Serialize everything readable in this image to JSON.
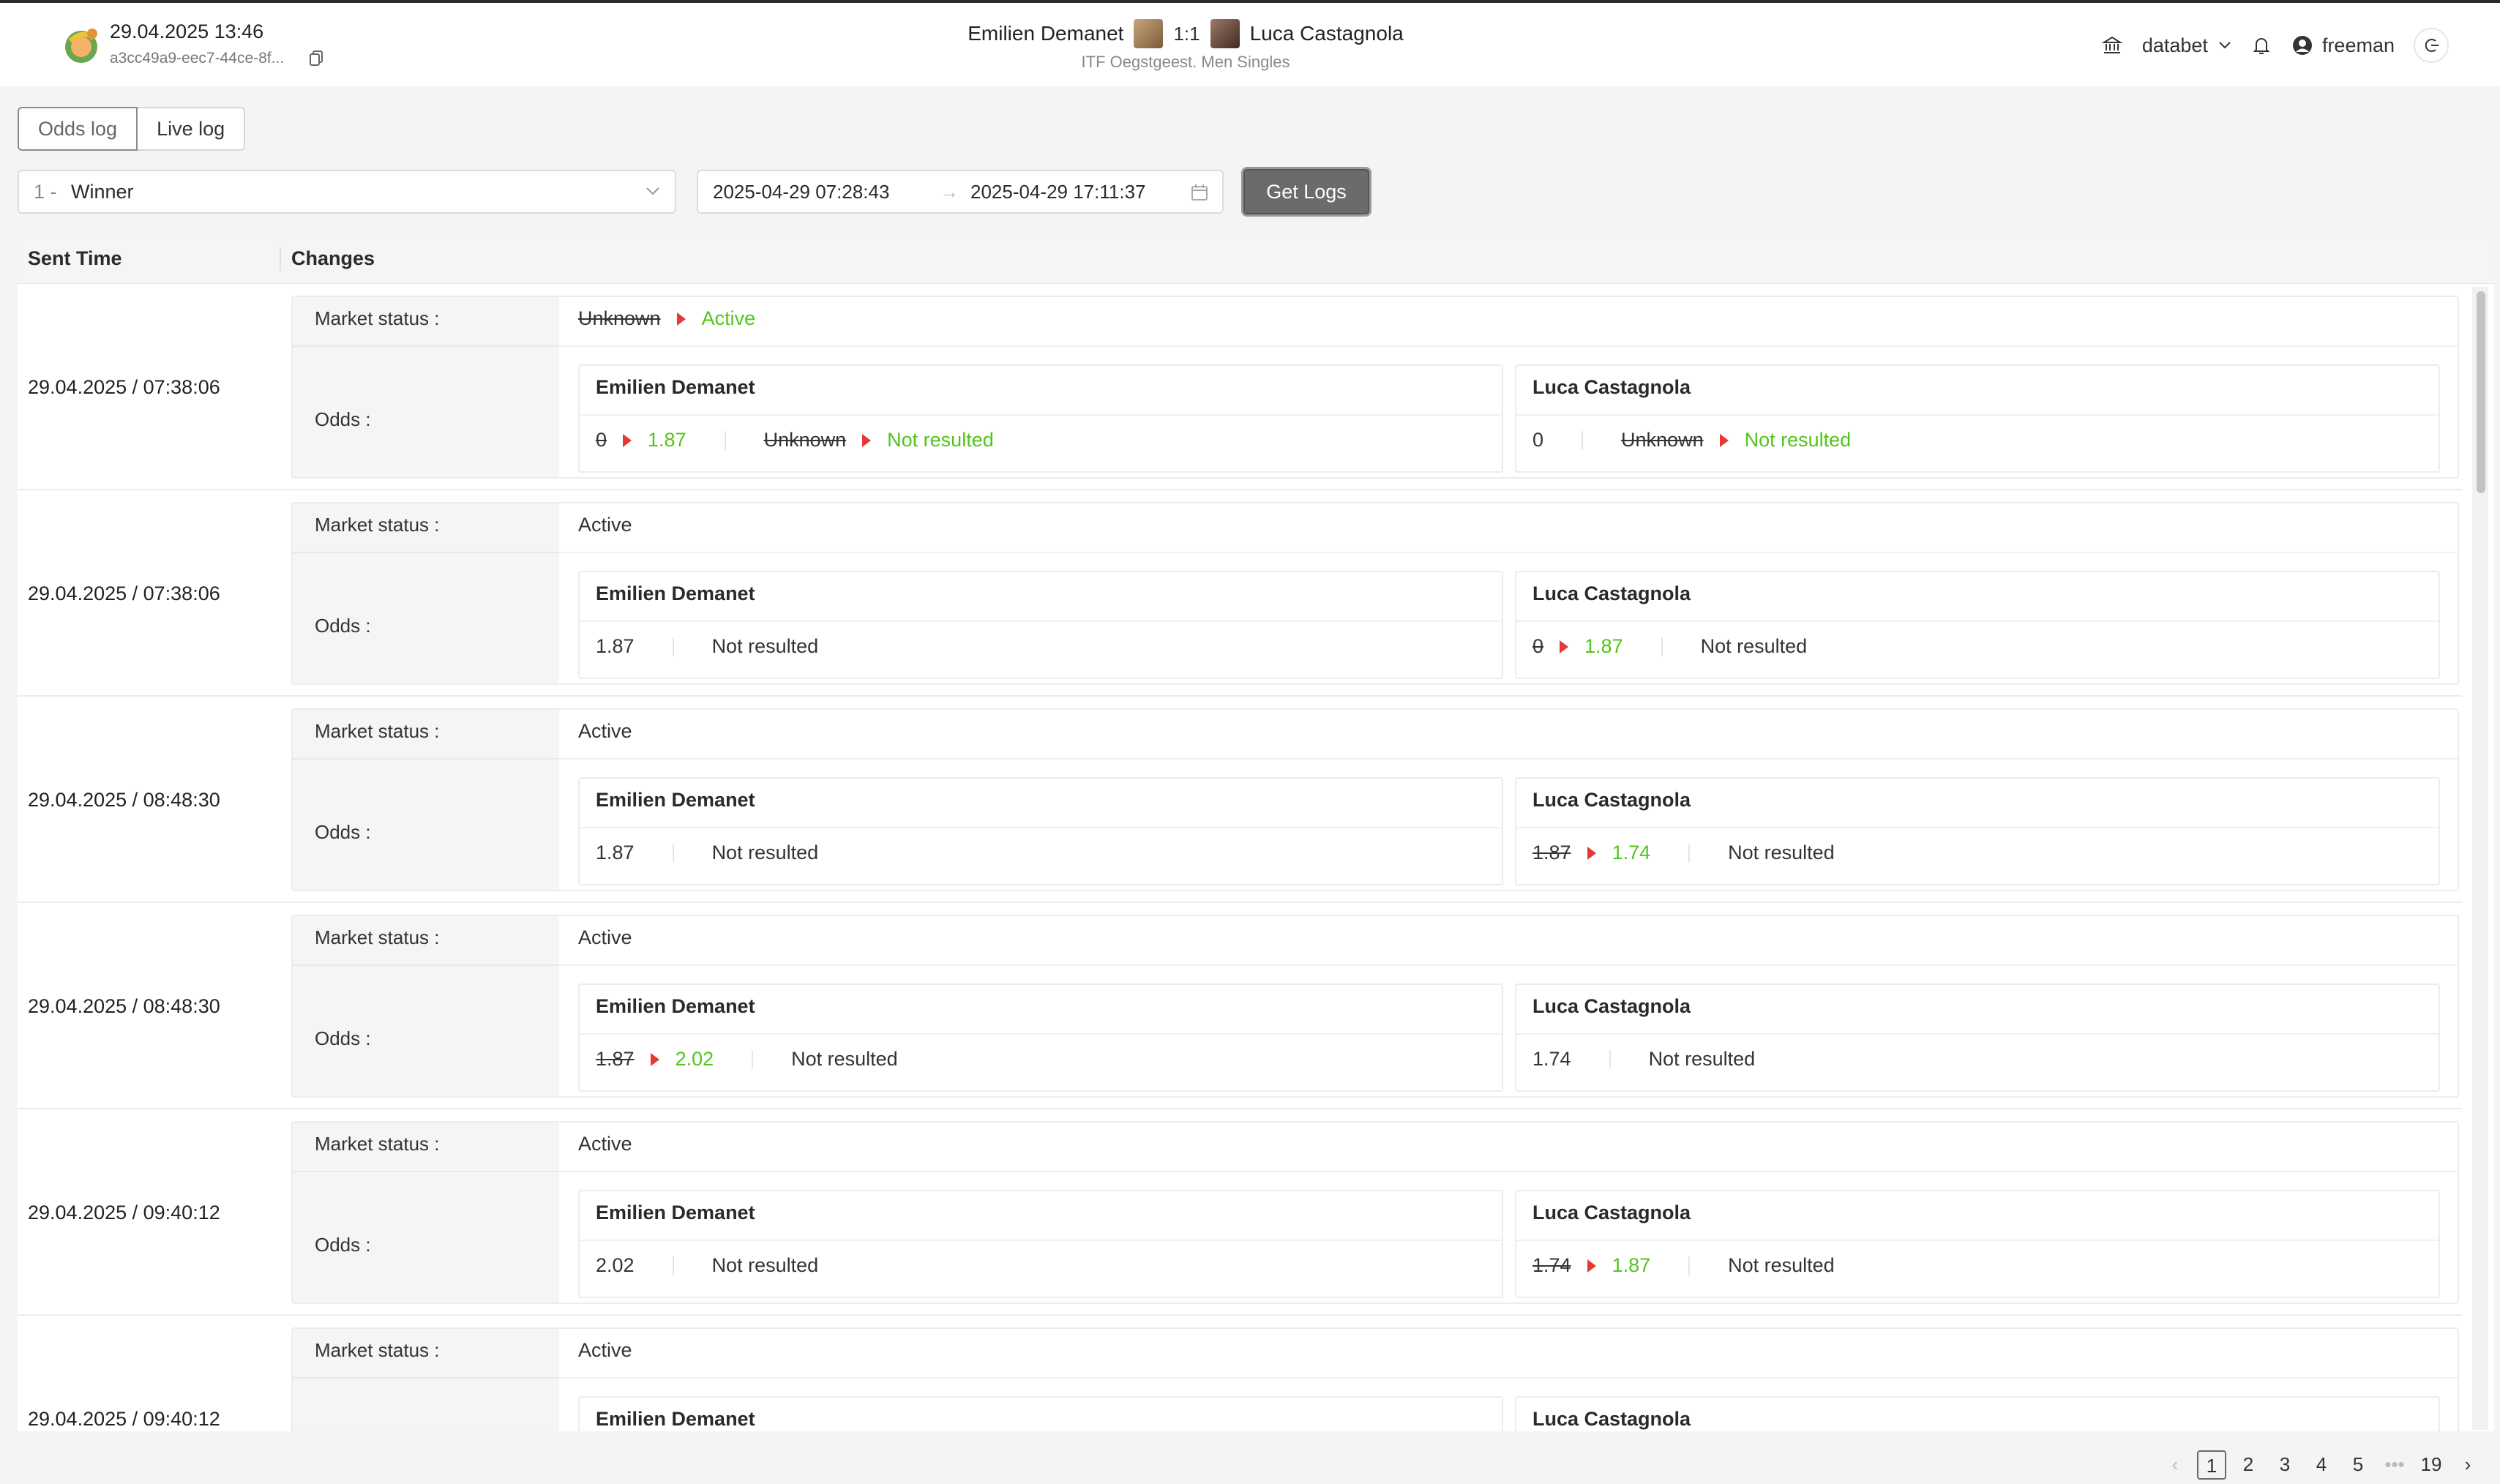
{
  "header": {
    "datetime": "29.04.2025 13:46",
    "event_id": "a3cc49a9-eec7-44ce-8f...",
    "home_player": "Emilien Demanet",
    "score": "1:1",
    "away_player": "Luca Castagnola",
    "league": "ITF Oegstgeest. Men Singles",
    "brand": "databet",
    "username": "freeman"
  },
  "tabs": [
    "Odds log",
    "Live log"
  ],
  "filters": {
    "market_number": "1 -",
    "market_name": "Winner",
    "date_from": "2025-04-29 07:28:43",
    "date_to": "2025-04-29 17:11:37",
    "get_logs_label": "Get Logs"
  },
  "table": {
    "col_sent_time": "Sent Time",
    "col_changes": "Changes",
    "market_status_label": "Market status :",
    "odds_label": "Odds :",
    "rows": [
      {
        "sent": "29.04.2025 / 07:38:06",
        "status_old": "Unknown",
        "status_new": "Active",
        "left": {
          "name": "Emilien Demanet",
          "odd_old": "0",
          "odd_new": "1.87",
          "res_old": "Unknown",
          "res_new": "Not resulted"
        },
        "right": {
          "name": "Luca Castagnola",
          "odd": "0",
          "res_old": "Unknown",
          "res_new": "Not resulted"
        }
      },
      {
        "sent": "29.04.2025 / 07:38:06",
        "status": "Active",
        "left": {
          "name": "Emilien Demanet",
          "odd": "1.87",
          "res": "Not resulted"
        },
        "right": {
          "name": "Luca Castagnola",
          "odd_old": "0",
          "odd_new": "1.87",
          "res": "Not resulted"
        }
      },
      {
        "sent": "29.04.2025 / 08:48:30",
        "status": "Active",
        "left": {
          "name": "Emilien Demanet",
          "odd": "1.87",
          "res": "Not resulted"
        },
        "right": {
          "name": "Luca Castagnola",
          "odd_old": "1.87",
          "odd_new": "1.74",
          "res": "Not resulted"
        }
      },
      {
        "sent": "29.04.2025 / 08:48:30",
        "status": "Active",
        "left": {
          "name": "Emilien Demanet",
          "odd_old": "1.87",
          "odd_new": "2.02",
          "res": "Not resulted"
        },
        "right": {
          "name": "Luca Castagnola",
          "odd": "1.74",
          "res": "Not resulted"
        }
      },
      {
        "sent": "29.04.2025 / 09:40:12",
        "status": "Active",
        "left": {
          "name": "Emilien Demanet",
          "odd": "2.02",
          "res": "Not resulted"
        },
        "right": {
          "name": "Luca Castagnola",
          "odd_old": "1.74",
          "odd_new": "1.87",
          "res": "Not resulted"
        }
      },
      {
        "sent": "29.04.2025 / 09:40:12",
        "status": "Active",
        "left": {
          "name": "Emilien Demanet"
        },
        "right": {
          "name": "Luca Castagnola"
        }
      }
    ]
  },
  "pagination": {
    "pages": [
      "1",
      "2",
      "3",
      "4",
      "5"
    ],
    "ellipsis": "•••",
    "last": "19",
    "current": "1"
  },
  "colors": {
    "accent_green": "#52c41a",
    "arrow_red": "#e53935",
    "button_gray": "#6b6b6b"
  }
}
